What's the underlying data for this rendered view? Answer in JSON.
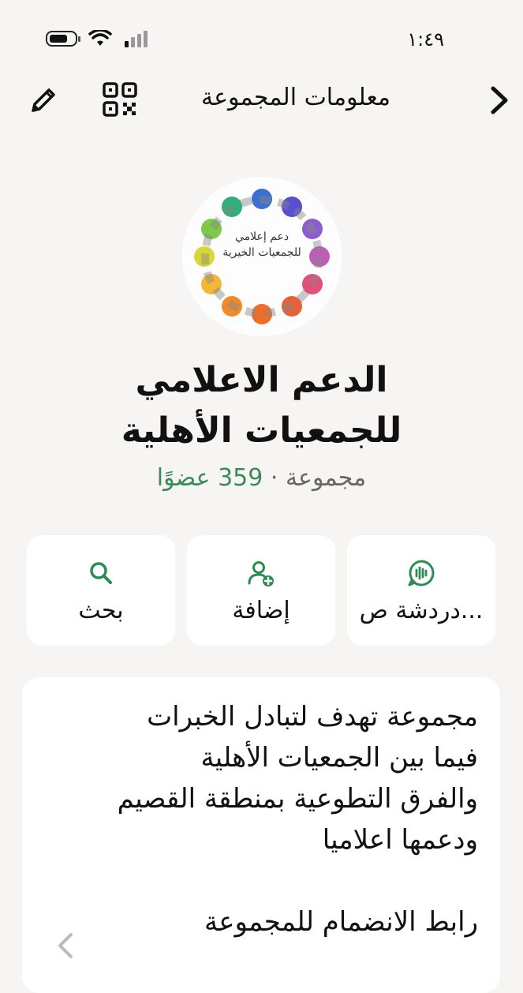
{
  "status_bar": {
    "time": "١:٤٩",
    "icons": [
      "battery-icon",
      "wifi-icon",
      "signal-icon"
    ]
  },
  "header": {
    "title": "معلومات المجموعة",
    "icons": [
      "edit-icon",
      "qr-code-icon",
      "back-chevron-icon"
    ]
  },
  "group": {
    "avatar_text_line1": "دعم إعلامي",
    "avatar_text_line2": "للجمعيات الخيرية",
    "name_line1": "الدعم الاعلامي",
    "name_line2": "للجمعيات الأهلية",
    "type": "مجموعة",
    "separator": " · ",
    "members": "359 عضوًا"
  },
  "actions": [
    {
      "label": "دردشة ص...",
      "icon": "voice-chat-icon"
    },
    {
      "label": "إضافة",
      "icon": "add-person-icon"
    },
    {
      "label": "بحث",
      "icon": "search-icon"
    }
  ],
  "description": {
    "lines": [
      "مجموعة تهدف لتبادل الخبرات",
      "فيما بين الجمعيات الأهلية",
      "والفرق التطوعية بمنطقة القصيم",
      "ودعمها اعلاميا"
    ],
    "join_label": "رابط الانضمام للمجموعة"
  },
  "colors": {
    "background": "#f7f5f3",
    "card": "#ffffff",
    "accent_green": "#3b8a5c"
  }
}
